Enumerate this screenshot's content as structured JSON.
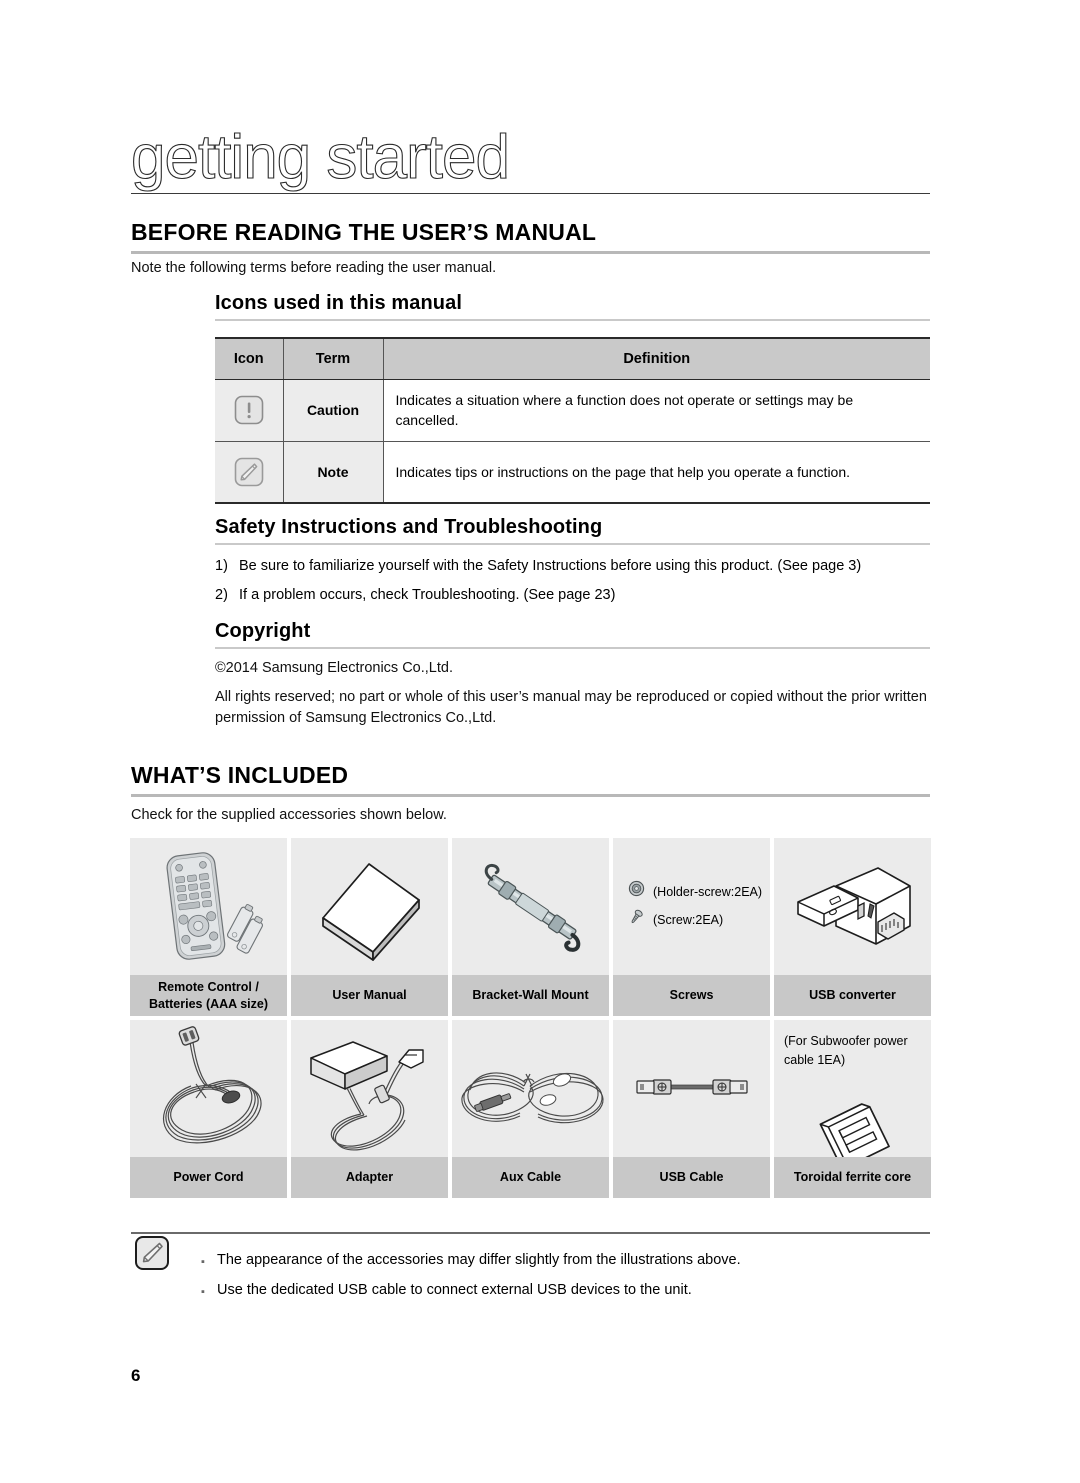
{
  "chapter": {
    "title": "getting started"
  },
  "section_before": {
    "heading": "BEFORE READING THE USER’S MANUAL",
    "intro": "Note the following terms before reading the user manual."
  },
  "icons_subsection": {
    "heading": "Icons used in this manual",
    "table": {
      "headers": [
        "Icon",
        "Term",
        "Definition"
      ],
      "rows": [
        {
          "icon": "caution-icon",
          "term": "Caution",
          "definition": "Indicates a situation where a function does not operate or settings may be cancelled."
        },
        {
          "icon": "note-icon",
          "term": "Note",
          "definition": "Indicates tips or instructions on the page that help you operate a function."
        }
      ]
    }
  },
  "safety_subsection": {
    "heading": "Safety Instructions and Troubleshooting",
    "items": [
      {
        "num": "1)",
        "text": "Be sure to familiarize yourself with the Safety Instructions before using this product. (See page 3)"
      },
      {
        "num": "2)",
        "text": "If a problem occurs, check Troubleshooting. (See page 23)"
      }
    ]
  },
  "copyright_subsection": {
    "heading": "Copyright",
    "line1": "©2014 Samsung Electronics Co.,Ltd.",
    "line2": "All rights reserved; no part or whole of this user’s manual may be reproduced or copied without the prior written permission of Samsung Electronics Co.,Ltd."
  },
  "section_included": {
    "heading": "WHAT’S INCLUDED",
    "intro": "Check for the supplied accessories shown below.",
    "accessories": [
      {
        "art": "remote-control",
        "label": "Remote Control /\nBatteries (AAA size)"
      },
      {
        "art": "user-manual",
        "label": "User Manual"
      },
      {
        "art": "wall-mount-bracket",
        "label": "Bracket-Wall Mount"
      },
      {
        "art": "screws",
        "label": "Screws",
        "screw_lines": [
          "(Holder-screw:2EA)",
          "(Screw:2EA)"
        ]
      },
      {
        "art": "usb-converter",
        "label": "USB converter"
      },
      {
        "art": "power-cord",
        "label": "Power Cord"
      },
      {
        "art": "adapter",
        "label": "Adapter"
      },
      {
        "art": "aux-cable",
        "label": "Aux Cable"
      },
      {
        "art": "usb-cable",
        "label": "USB Cable"
      },
      {
        "art": "toroidal-ferrite-core",
        "label": "Toroidal ferrite core",
        "sub": "(For Subwoofer power cable 1EA)"
      }
    ]
  },
  "bottom_note": {
    "icon": "note-icon",
    "items": [
      "The appearance of the accessories may differ slightly from the illustrations above.",
      "Use the dedicated USB cable to connect external USB devices to the unit."
    ]
  },
  "page_number": "6",
  "colors": {
    "table_header_bg": "#c9c9c9",
    "table_cell_bg": "#ececec",
    "acc_art_bg": "#ebebeb",
    "acc_label_bg": "#c8c8c8",
    "rule": "#b8b8b8"
  }
}
